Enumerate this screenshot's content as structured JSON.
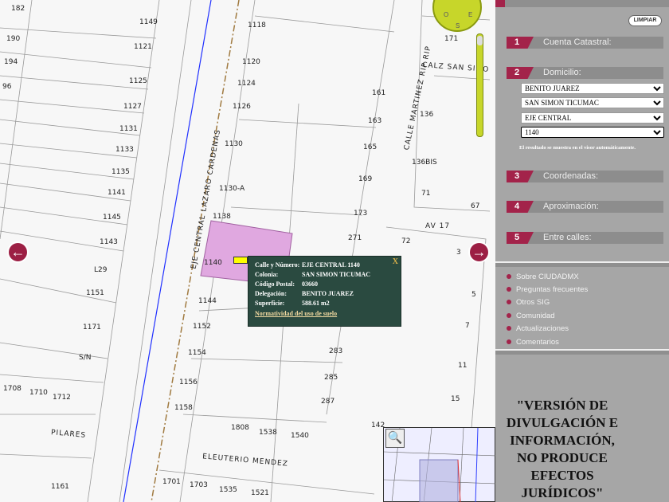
{
  "map": {
    "labels": [
      "182",
      "1149",
      "190",
      "1121",
      "194",
      "1125",
      "96",
      "1127",
      "1131",
      "1133",
      "1135",
      "1141",
      "1145",
      "1143",
      "L29",
      "1151",
      "1171",
      "S/N",
      "1708",
      "1710",
      "1712",
      "1161",
      "1118",
      "1120",
      "1124",
      "1126",
      "1130",
      "1130-A",
      "1138",
      "1140",
      "1144",
      "1152",
      "1154",
      "1156",
      "1158",
      "1808",
      "1538",
      "1540",
      "1701",
      "1703",
      "1535",
      "1521",
      "161",
      "163",
      "165",
      "169",
      "173",
      "271",
      "283",
      "285",
      "287",
      "142",
      "171",
      "136",
      "136BIS",
      "71",
      "67",
      "72",
      "3",
      "5",
      "7",
      "11",
      "15"
    ],
    "streets": {
      "eje_central": "EJE CENTRAL LAZARO CARDENAS",
      "martinez": "CALLE MARTINEZ RIP RIP",
      "calz_san_simon": "CALZ SAN SIMO",
      "av17": "AV 17",
      "pilares": "PILARES",
      "eleuterio": "ELEUTERIO MENDEZ"
    },
    "parcel_color": "#e0a8e0",
    "compass": {
      "o": "O",
      "e": "E",
      "s": "S"
    },
    "nav_left": "←",
    "nav_right": "→",
    "magnify": "🔍"
  },
  "popup": {
    "close": "X",
    "rows": [
      {
        "k": "Calle y Número:",
        "v": "EJE CENTRAL 1140"
      },
      {
        "k": "Colonia:",
        "v": "SAN SIMON TICUMAC"
      },
      {
        "k": "Código Postal:",
        "v": "03660"
      },
      {
        "k": "Delegación:",
        "v": "BENITO JUAREZ"
      },
      {
        "k": "Superficie:",
        "v": "588.61 m2"
      }
    ],
    "link": "Normatividad del uso de suelo"
  },
  "sidebar": {
    "limpiar": "LIMPIAR",
    "sections": [
      {
        "num": "1",
        "label": "Cuenta Catastral:"
      },
      {
        "num": "2",
        "label": "Domicilio:"
      },
      {
        "num": "3",
        "label": "Coordenadas:"
      },
      {
        "num": "4",
        "label": "Aproximación:"
      },
      {
        "num": "5",
        "label": "Entre calles:"
      }
    ],
    "selects": [
      "BENITO JUAREZ",
      "SAN SIMON TICUMAC",
      "EJE CENTRAL",
      "1140"
    ],
    "hint": "El resultado se muestra en el visor automáticamente.",
    "links": [
      "Sobre CIUDADMX",
      "Preguntas frecuentes",
      "Otros SIG",
      "Comunidad",
      "Actualizaciones",
      "Comentarios"
    ],
    "disclaimer": "\"VERSIÓN DE DIVULGACIÓN E INFORMACIÓN, NO PRODUCE EFECTOS JURÍDICOS\""
  },
  "colors": {
    "accent": "#a3234a",
    "popup_bg": "#2a4a40",
    "sidebar_bg": "#a6a6a6"
  }
}
